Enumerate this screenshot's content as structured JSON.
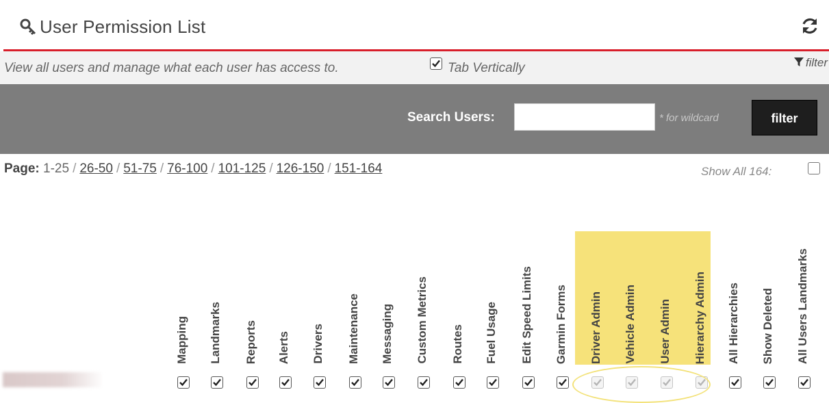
{
  "header": {
    "title": "User Permission List",
    "title_icon": "key-icon",
    "refresh_icon": "refresh-icon",
    "accent_color": "#d81e2a"
  },
  "info": {
    "text": "View all users and manage what each user has access to.",
    "tab_vertically_label": "Tab Vertically",
    "tab_vertically_checked": true,
    "filter_link_label": "filter"
  },
  "search": {
    "label": "Search Users:",
    "value": "",
    "hint": "* for wildcard",
    "button_label": "filter"
  },
  "pagination": {
    "label": "Page:",
    "current": "1-25",
    "pages": [
      "26-50",
      "51-75",
      "76-100",
      "101-125",
      "126-150",
      "151-164"
    ],
    "show_all_label": "Show All 164:",
    "show_all_checked": false
  },
  "columns": [
    {
      "label": "Mapping",
      "highlighted": false
    },
    {
      "label": "Landmarks",
      "highlighted": false
    },
    {
      "label": "Reports",
      "highlighted": false
    },
    {
      "label": "Alerts",
      "highlighted": false
    },
    {
      "label": "Drivers",
      "highlighted": false
    },
    {
      "label": "Maintenance",
      "highlighted": false
    },
    {
      "label": "Messaging",
      "highlighted": false
    },
    {
      "label": "Custom Metrics",
      "highlighted": false
    },
    {
      "label": "Routes",
      "highlighted": false
    },
    {
      "label": "Fuel Usage",
      "highlighted": false
    },
    {
      "label": "Edit Speed Limits",
      "highlighted": false
    },
    {
      "label": "Garmin Forms",
      "highlighted": false
    },
    {
      "label": "Driver Admin",
      "highlighted": true
    },
    {
      "label": "Vehicle Admin",
      "highlighted": true
    },
    {
      "label": "User Admin",
      "highlighted": true
    },
    {
      "label": "Hierarchy Admin",
      "highlighted": true
    },
    {
      "label": "All Hierarchies",
      "highlighted": false
    },
    {
      "label": "Show Deleted",
      "highlighted": false
    },
    {
      "label": "All Users Landmarks",
      "highlighted": false
    }
  ],
  "rows": [
    {
      "checked": [
        true,
        true,
        true,
        true,
        true,
        true,
        true,
        true,
        true,
        true,
        true,
        true,
        true,
        true,
        true,
        true,
        true,
        true,
        true
      ],
      "disabled": [
        false,
        false,
        false,
        false,
        false,
        false,
        false,
        false,
        false,
        false,
        false,
        false,
        true,
        true,
        true,
        true,
        false,
        false,
        false
      ]
    }
  ]
}
